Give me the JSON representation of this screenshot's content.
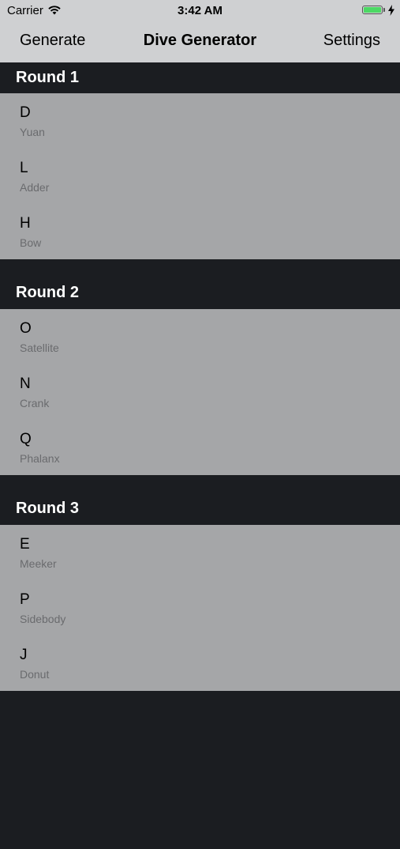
{
  "status_bar": {
    "carrier": "Carrier",
    "time": "3:42 AM",
    "battery_color": "#4cd964"
  },
  "nav": {
    "left_button": "Generate",
    "title": "Dive Generator",
    "right_button": "Settings"
  },
  "rounds": [
    {
      "title": "Round 1",
      "dives": [
        {
          "letter": "D",
          "name": "Yuan"
        },
        {
          "letter": "L",
          "name": "Adder"
        },
        {
          "letter": "H",
          "name": "Bow"
        }
      ]
    },
    {
      "title": "Round 2",
      "dives": [
        {
          "letter": "O",
          "name": "Satellite"
        },
        {
          "letter": "N",
          "name": "Crank"
        },
        {
          "letter": "Q",
          "name": "Phalanx"
        }
      ]
    },
    {
      "title": "Round 3",
      "dives": [
        {
          "letter": "E",
          "name": "Meeker"
        },
        {
          "letter": "P",
          "name": "Sidebody"
        },
        {
          "letter": "J",
          "name": "Donut"
        }
      ]
    }
  ]
}
